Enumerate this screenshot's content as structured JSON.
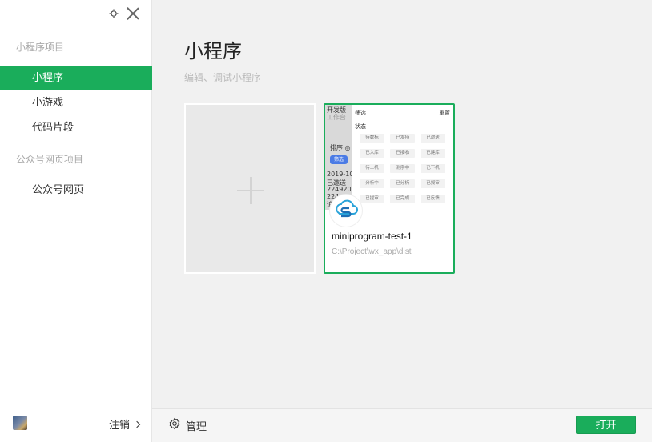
{
  "sidebar": {
    "group_miniprogram": "小程序项目",
    "items": [
      {
        "label": "小程序"
      },
      {
        "label": "小游戏"
      },
      {
        "label": "代码片段"
      }
    ],
    "group_mp": "公众号网页项目",
    "mp_items": [
      {
        "label": "公众号网页"
      }
    ],
    "logout_label": "注销"
  },
  "main": {
    "title": "小程序",
    "subtitle": "编辑、调试小程序",
    "project": {
      "name": "miniprogram-test-1",
      "path": "C:\\Project\\wx_app\\dist"
    },
    "thumbnail": {
      "left_lines": [
        "开发版",
        "工作台",
        "排序 ◎",
        "筛选",
        "2019-10-2",
        "已邀送",
        "22492060",
        "224",
        "追"
      ],
      "filter_title": "筛选",
      "reset": "重置",
      "status_label": "状态",
      "chips": [
        "待数标",
        "已发持",
        "已邀送",
        "已入库",
        "已接收",
        "已建库",
        "待上机",
        "测序中",
        "已下机",
        "分析中",
        "已分析",
        "已报审",
        "已提审",
        "已完成",
        "已反馈"
      ]
    }
  },
  "footer": {
    "manage_label": "管理",
    "open_label": "打开"
  },
  "colors": {
    "accent": "#1aad5b"
  }
}
